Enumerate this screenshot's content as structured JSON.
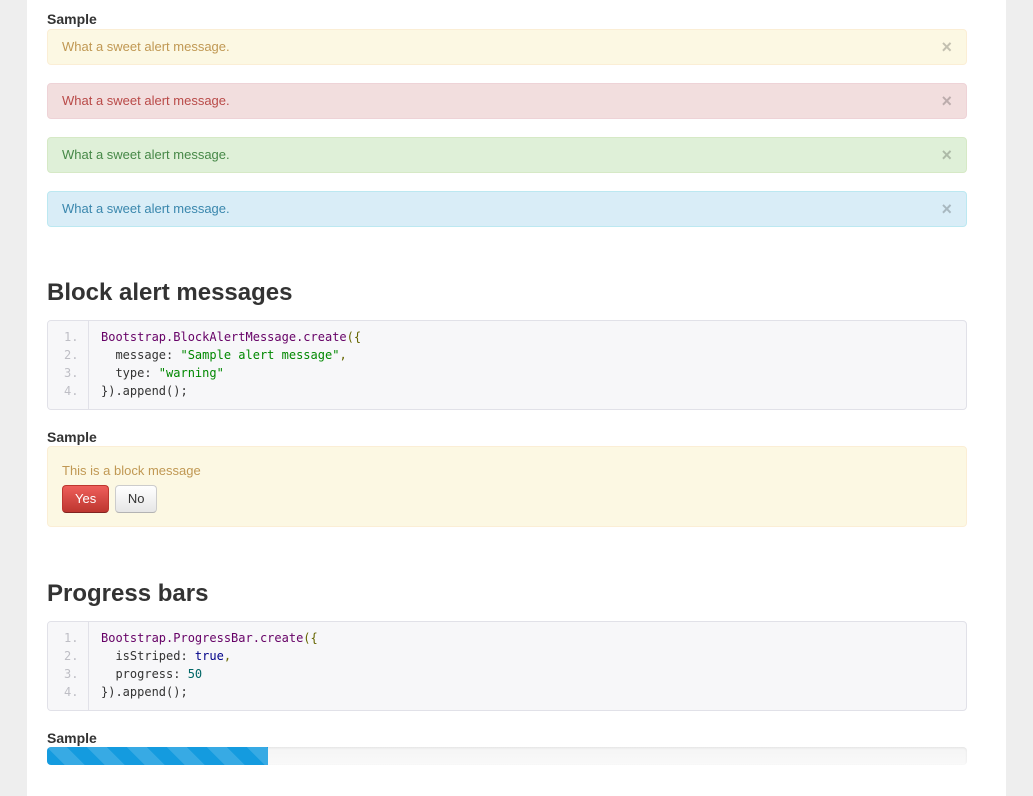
{
  "alerts_section": {
    "sample_label": "Sample",
    "alerts": [
      {
        "type": "warning",
        "message": "What a sweet alert message.",
        "close": "×"
      },
      {
        "type": "error",
        "message": "What a sweet alert message.",
        "close": "×"
      },
      {
        "type": "success",
        "message": "What a sweet alert message.",
        "close": "×"
      },
      {
        "type": "info",
        "message": "What a sweet alert message.",
        "close": "×"
      }
    ]
  },
  "block_section": {
    "title": "Block alert messages",
    "line_numbers": [
      "1.",
      "2.",
      "3.",
      "4."
    ],
    "code": {
      "l1_fn": "Bootstrap.BlockAlertMessage.create",
      "l1_p": "({",
      "l2_key": "  message: ",
      "l2_val": "\"Sample alert message\"",
      "l2_p": ",",
      "l3_key": "  type: ",
      "l3_val": "\"warning\"",
      "l4": "}).append();"
    },
    "sample_label": "Sample",
    "block_message": "This is a block message",
    "yes_label": "Yes",
    "no_label": "No"
  },
  "progress_section": {
    "title": "Progress bars",
    "line_numbers": [
      "1.",
      "2.",
      "3.",
      "4."
    ],
    "code": {
      "l1_fn": "Bootstrap.ProgressBar.create",
      "l1_p": "({",
      "l2_key": "  isStriped: ",
      "l2_val": "true",
      "l2_p": ",",
      "l3_key": "  progress: ",
      "l3_val": "50",
      "l4": "}).append();"
    },
    "sample_label": "Sample",
    "progress_fraction": 0.24,
    "bar_color": "#149bdf"
  }
}
